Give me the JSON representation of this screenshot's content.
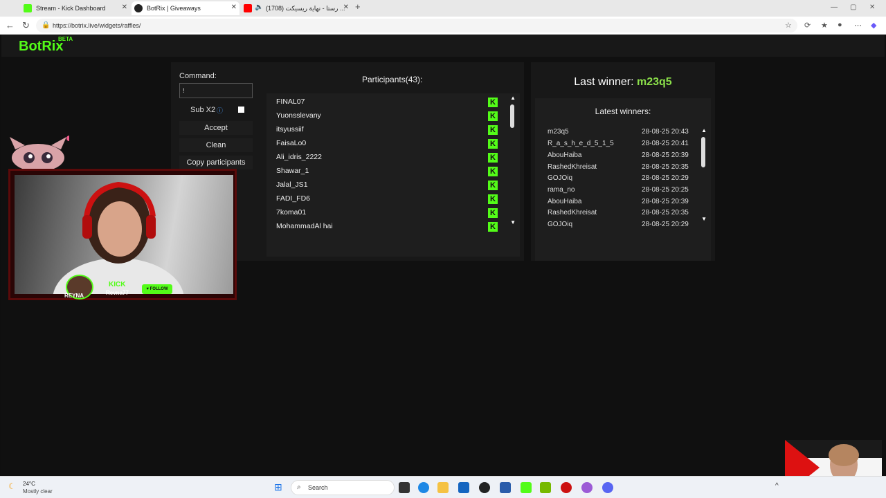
{
  "browser": {
    "tabs": [
      {
        "title": "Stream - Kick Dashboard",
        "icon": "kick-icon",
        "color": "#53fc18"
      },
      {
        "title": "BotRix | Giveaways",
        "icon": "botrix-icon",
        "color": "#222222"
      },
      {
        "title": "(1708) رستا - نهاية ريسيكت ...",
        "icon": "youtube-icon",
        "color": "#ff0000"
      }
    ],
    "url": "https://botrix.live/widgets/raffles/"
  },
  "app": {
    "logo": "BotRix",
    "badge": "BETA",
    "accent": "#53fc18"
  },
  "controls": {
    "command_label": "Command:",
    "command_value": "!",
    "sub_label": "Sub X2",
    "accept": "Accept",
    "clean": "Clean",
    "copy": "Copy participants"
  },
  "participants": {
    "title": "Participants(43):",
    "items": [
      "FINAL07",
      "Yuonsslevany",
      "itsyussiif",
      "FaisaLo0",
      "Ali_idris_2222",
      "Shawar_1",
      "Jalal_JS1",
      "FADI_FD6",
      "7koma01",
      "MohammadAl hai"
    ]
  },
  "winner": {
    "label": "Last winner:",
    "name": "m23q5"
  },
  "latest": {
    "title": "Latest winners:",
    "rows": [
      {
        "name": "m23q5",
        "time": "28-08-25 20:43"
      },
      {
        "name": "R_a_s_h_e_d_5_1_5",
        "time": "28-08-25 20:41"
      },
      {
        "name": "AbouHaiba",
        "time": "28-08-25 20:39"
      },
      {
        "name": "RashedKhreisat",
        "time": "28-08-25 20:35"
      },
      {
        "name": "GOJOiq",
        "time": "28-08-25 20:29"
      },
      {
        "name": "rama_no",
        "time": "28-08-25 20:25"
      },
      {
        "name": "AbouHaiba",
        "time": "28-08-25 20:39"
      },
      {
        "name": "RashedKhreisat",
        "time": "28-08-25 20:35"
      },
      {
        "name": "GOJOiq",
        "time": "28-08-25 20:29"
      }
    ]
  },
  "overlay": {
    "kick": "KICK",
    "channel": "Revna77",
    "follow": "FOLLOW",
    "logo_text": "REYNA"
  },
  "taskbar": {
    "temp": "24°C",
    "weather": "Mostly clear",
    "search": "Search"
  }
}
